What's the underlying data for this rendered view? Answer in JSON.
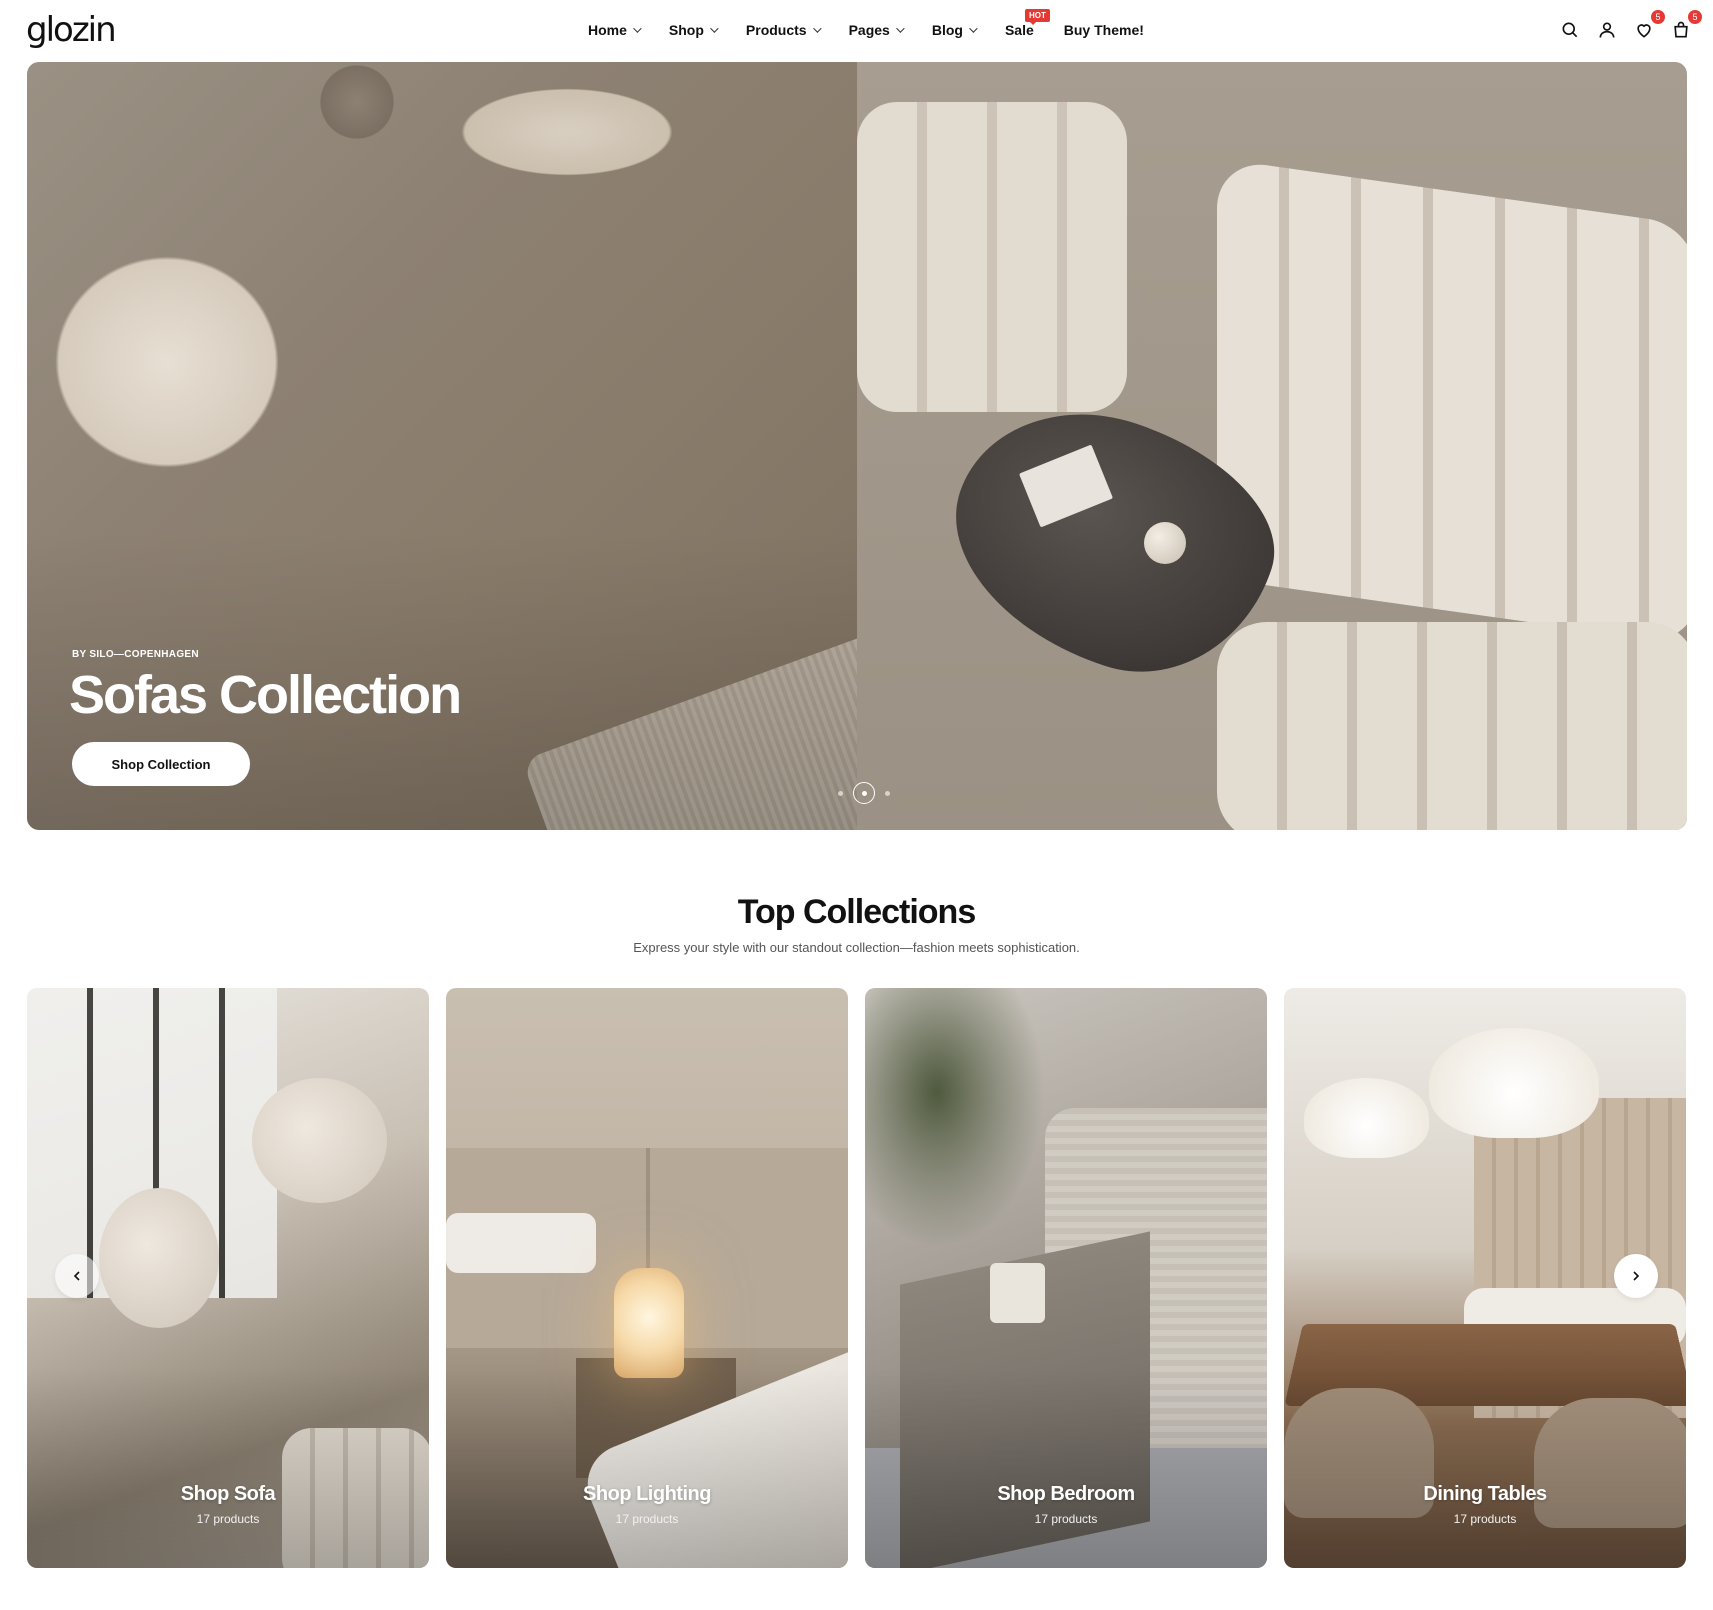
{
  "header": {
    "logo": "glozin",
    "nav": [
      {
        "label": "Home",
        "dropdown": true
      },
      {
        "label": "Shop",
        "dropdown": true
      },
      {
        "label": "Products",
        "dropdown": true
      },
      {
        "label": "Pages",
        "dropdown": true
      },
      {
        "label": "Blog",
        "dropdown": true
      },
      {
        "label": "Sale",
        "dropdown": false,
        "badge": "HOT"
      },
      {
        "label": "Buy Theme!",
        "dropdown": false
      }
    ],
    "icons": [
      "search-icon",
      "user-icon",
      "wishlist-icon",
      "cart-icon"
    ],
    "wishlist_count": "5",
    "cart_count": "5"
  },
  "hero": {
    "subtitle": "BY SILO—COPENHAGEN",
    "title": "Sofas Collection",
    "button": "Shop Collection",
    "slides": 3,
    "active_slide": 2
  },
  "collections": {
    "title": "Top Collections",
    "subtitle": "Express your style with our standout collection—fashion meets sophistication.",
    "items": [
      {
        "title": "Shop Sofa",
        "count": "17 products"
      },
      {
        "title": "Shop Lighting",
        "count": "17 products"
      },
      {
        "title": "Shop Bedroom",
        "count": "17 products"
      },
      {
        "title": "Dining Tables",
        "count": "17 products"
      }
    ]
  },
  "colors": {
    "accent": "#e53935",
    "text": "#111111",
    "background": "#ffffff"
  }
}
